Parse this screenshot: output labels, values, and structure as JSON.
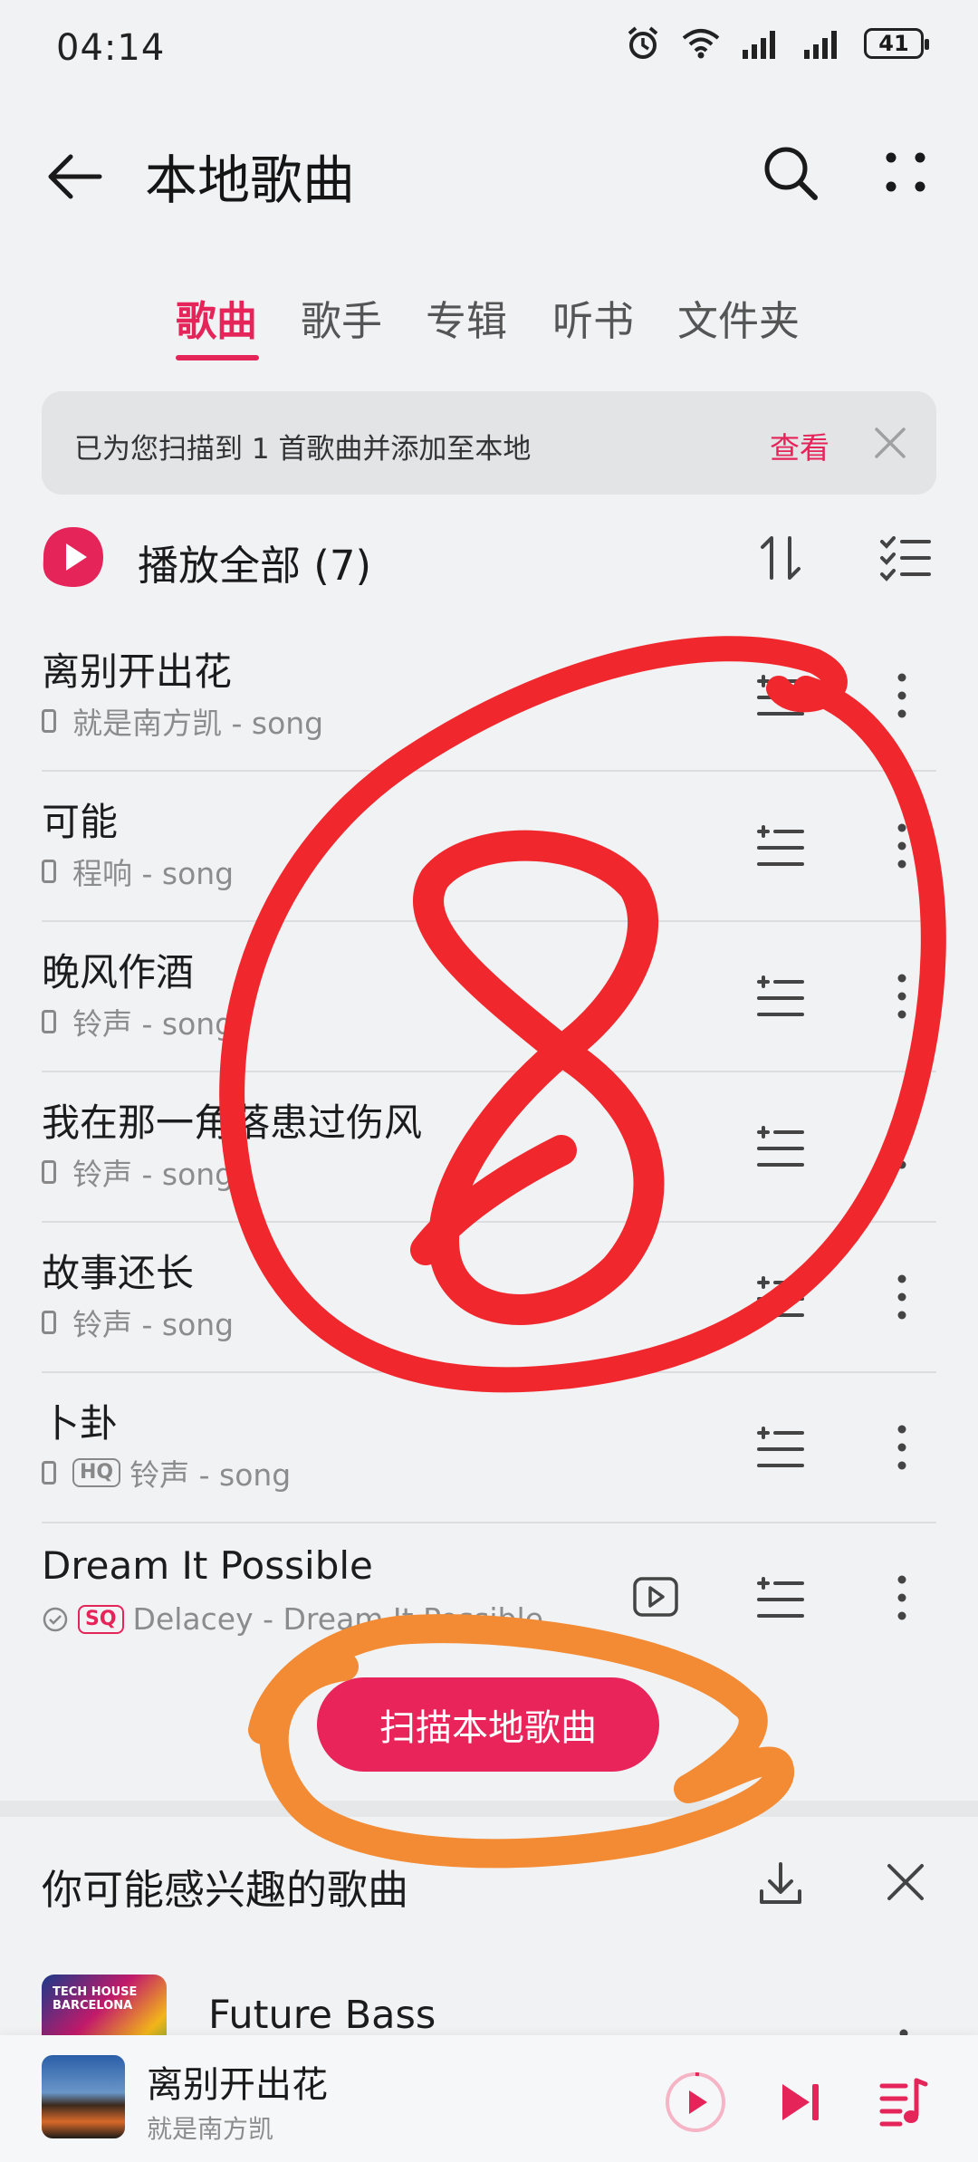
{
  "status_bar": {
    "time": "04:14",
    "battery": "41"
  },
  "header": {
    "title": "本地歌曲"
  },
  "tabs": [
    {
      "label": "歌曲",
      "active": true
    },
    {
      "label": "歌手",
      "active": false
    },
    {
      "label": "专辑",
      "active": false
    },
    {
      "label": "听书",
      "active": false
    },
    {
      "label": "文件夹",
      "active": false
    }
  ],
  "notice": {
    "text": "已为您扫描到 1 首歌曲并添加至本地",
    "action": "查看"
  },
  "play_all": {
    "label": "播放全部 (7)"
  },
  "songs": [
    {
      "title": "离别开出花",
      "subtitle": "就是南方凯 - song"
    },
    {
      "title": "可能",
      "subtitle": "程响 - song"
    },
    {
      "title": "晚风作酒",
      "subtitle": "铃声 - song"
    },
    {
      "title": "我在那一角落患过伤风",
      "subtitle": "铃声 - song"
    },
    {
      "title": "故事还长",
      "subtitle": "铃声 - song"
    },
    {
      "title": "卜卦",
      "badge": "HQ",
      "subtitle": "铃声 - song"
    },
    {
      "title": "Dream It Possible",
      "badge": "SQ",
      "subtitle": "Delacey - Dream It Possible"
    }
  ],
  "scan_button": {
    "label": "扫描本地歌曲"
  },
  "recommend": {
    "title": "你可能感兴趣的歌曲",
    "thumb_text": "TECH HOUSE BARCELONA",
    "song": "Future Bass"
  },
  "player": {
    "title": "离别开出花",
    "artist": "就是南方凯"
  },
  "annotations": {
    "circle_label": "8"
  },
  "colors": {
    "accent": "#e5245a",
    "annotation_red": "#f0282d",
    "annotation_orange": "#f28b34"
  }
}
